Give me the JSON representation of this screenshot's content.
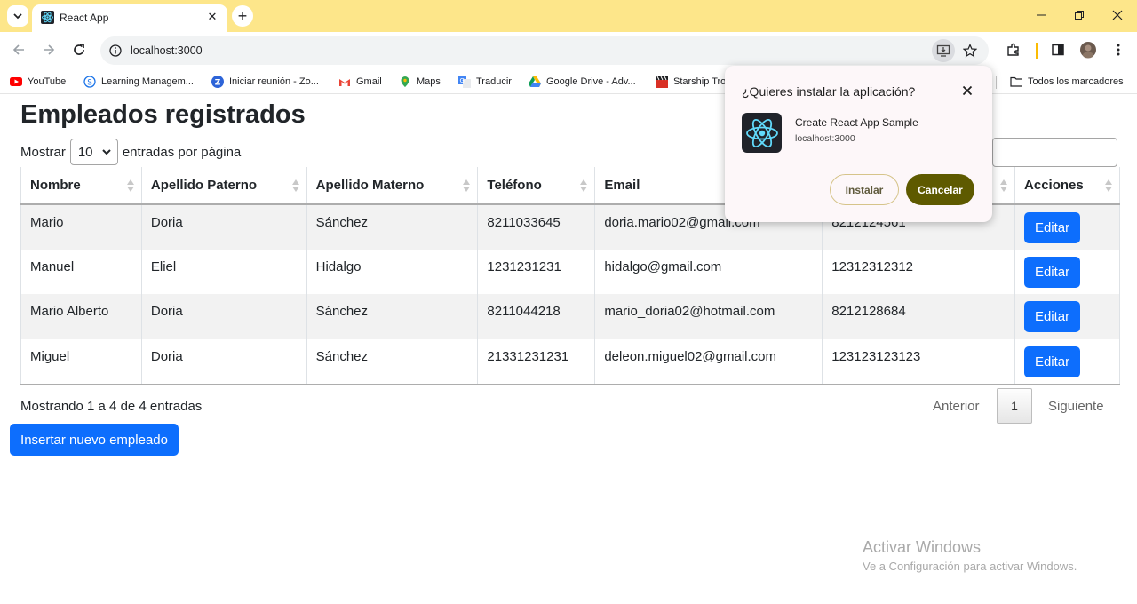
{
  "browser": {
    "tab_title": "React App",
    "url": "localhost:3000",
    "colors": {
      "frame": "#fde68a",
      "accent": "#0d6efd"
    }
  },
  "bookmarks": {
    "items": [
      {
        "label": "YouTube",
        "icon": "youtube-icon"
      },
      {
        "label": "Learning Managem...",
        "icon": "lms-icon"
      },
      {
        "label": "Iniciar reunión - Zo...",
        "icon": "zoom-icon"
      },
      {
        "label": "Gmail",
        "icon": "gmail-icon"
      },
      {
        "label": "Maps",
        "icon": "maps-icon"
      },
      {
        "label": "Traducir",
        "icon": "translate-icon"
      },
      {
        "label": "Google Drive - Adv...",
        "icon": "drive-icon"
      },
      {
        "label": "Starship Tro",
        "icon": "clapper-icon"
      }
    ],
    "all_bookmarks": "Todos los marcadores"
  },
  "page": {
    "title": "Empleados registrados",
    "length_prefix": "Mostrar",
    "length_value": "10",
    "length_suffix": "entradas por página",
    "columns": [
      "Nombre",
      "Apellido Paterno",
      "Apellido Materno",
      "Teléfono",
      "Email",
      "",
      "Acciones"
    ],
    "rows": [
      {
        "nombre": "Mario",
        "paterno": "Doria",
        "materno": "Sánchez",
        "telefono": "8211033645",
        "email": "doria.mario02@gmail.com",
        "otro": "8212124561",
        "accion": "Editar"
      },
      {
        "nombre": "Manuel",
        "paterno": "Eliel",
        "materno": "Hidalgo",
        "telefono": "1231231231",
        "email": "hidalgo@gmail.com",
        "otro": "12312312312",
        "accion": "Editar"
      },
      {
        "nombre": "Mario Alberto",
        "paterno": "Doria",
        "materno": "Sánchez",
        "telefono": "8211044218",
        "email": "mario_doria02@hotmail.com",
        "otro": "8212128684",
        "accion": "Editar"
      },
      {
        "nombre": "Miguel",
        "paterno": "Doria",
        "materno": "Sánchez",
        "telefono": "21331231231",
        "email": "deleon.miguel02@gmail.com",
        "otro": "123123123123",
        "accion": "Editar"
      }
    ],
    "info": "Mostrando 1 a 4 de 4 entradas",
    "pagination": {
      "prev": "Anterior",
      "current": "1",
      "next": "Siguiente"
    },
    "insert_button": "Insertar nuevo empleado"
  },
  "install_popup": {
    "title": "¿Quieres instalar la aplicación?",
    "app_name": "Create React App Sample",
    "origin": "localhost:3000",
    "install_label": "Instalar",
    "cancel_label": "Cancelar"
  },
  "watermark": {
    "line1": "Activar Windows",
    "line2": "Ve a Configuración para activar Windows."
  }
}
